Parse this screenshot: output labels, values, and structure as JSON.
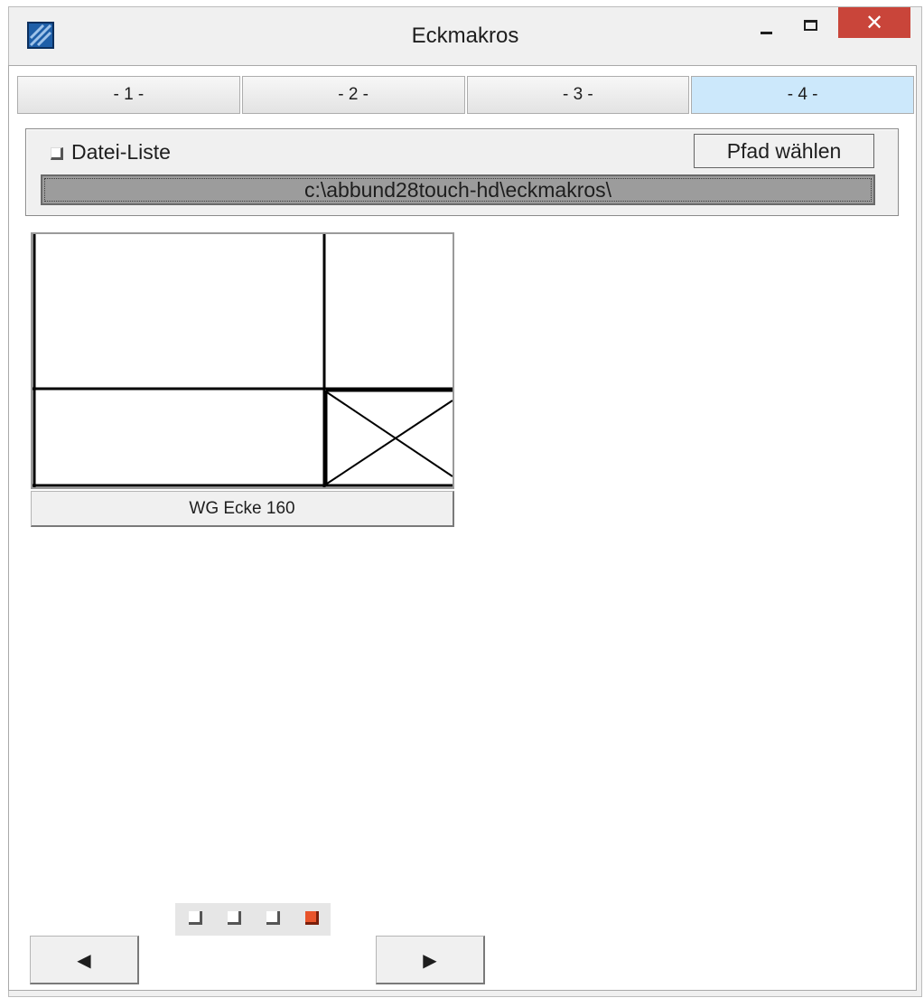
{
  "window": {
    "title": "Eckmakros",
    "close_glyph": "✕"
  },
  "tabs": [
    {
      "label": "- 1 -",
      "active": false
    },
    {
      "label": "- 2 -",
      "active": false
    },
    {
      "label": "- 3 -",
      "active": false
    },
    {
      "label": "- 4 -",
      "active": true
    }
  ],
  "file_panel": {
    "checkbox_label": "Datei-Liste",
    "checkbox_checked": false,
    "choose_path_label": "Pfad wählen",
    "path_value": "c:\\abbund28touch-hd\\eckmakros\\"
  },
  "macros": [
    {
      "label": "WG Ecke 160",
      "preview_icon": "corner-macro-preview"
    }
  ],
  "pager": {
    "page_count": 4,
    "current_page": 4
  },
  "nav": {
    "prev_glyph": "◀",
    "next_glyph": "▶"
  },
  "colors": {
    "active_tab": "#cce8fb",
    "close_button": "#c9453a",
    "active_page": "#e8532a"
  }
}
